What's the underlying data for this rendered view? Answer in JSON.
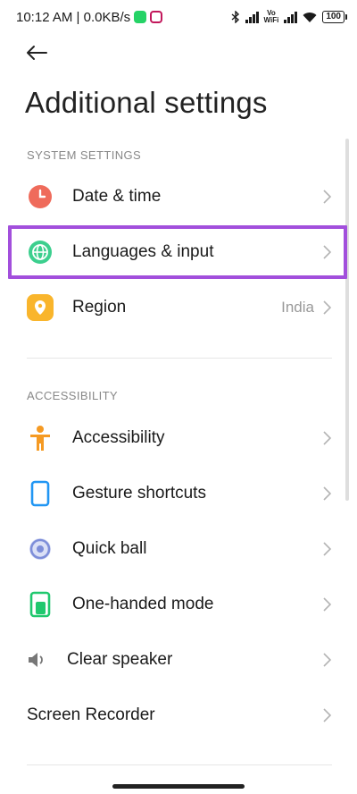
{
  "status_bar": {
    "time_net": "10:12 AM | 0.0KB/s",
    "vowifi": "Vo\nWiFi",
    "battery": "100"
  },
  "header": {
    "title": "Additional settings"
  },
  "sections": {
    "system": {
      "header": "SYSTEM SETTINGS",
      "items": [
        {
          "label": "Date & time"
        },
        {
          "label": "Languages & input"
        },
        {
          "label": "Region",
          "value": "India"
        }
      ]
    },
    "accessibility": {
      "header": "ACCESSIBILITY",
      "items": [
        {
          "label": "Accessibility"
        },
        {
          "label": "Gesture shortcuts"
        },
        {
          "label": "Quick ball"
        },
        {
          "label": "One-handed mode"
        },
        {
          "label": "Clear speaker"
        },
        {
          "label": "Screen Recorder"
        }
      ]
    }
  },
  "colors": {
    "highlight": "#a24fdc",
    "clock_icon": "#ef6b5b",
    "globe_icon": "#3ccf8e",
    "region_icon": "#f9b52c",
    "accessibility_icon": "#f59a23",
    "gesture_icon": "#2196f3",
    "quickball_icon": "#7e8ed9",
    "onehand_icon": "#20c86e"
  },
  "icons": [
    "back-arrow-icon",
    "clock-icon",
    "globe-icon",
    "location-pin-icon",
    "person-icon",
    "phone-outline-icon",
    "quick-ball-icon",
    "one-handed-icon",
    "speaker-icon",
    "chevron-right-icon"
  ]
}
